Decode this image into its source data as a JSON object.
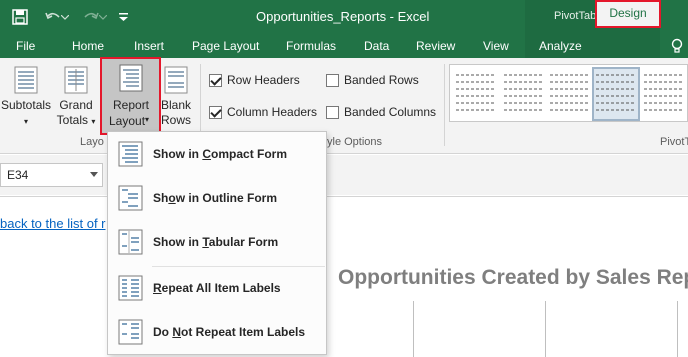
{
  "titlebar": {
    "document_title": "Opportunities_Reports - Excel",
    "context_tab_group": "PivotTable Tools",
    "save_icon": "save-icon",
    "undo_icon": "undo-icon",
    "redo_icon": "redo-icon",
    "customize_icon": "customize-qat-icon"
  },
  "tabs": {
    "file": "File",
    "home": "Home",
    "insert": "Insert",
    "page_layout": "Page Layout",
    "formulas": "Formulas",
    "data": "Data",
    "review": "Review",
    "view": "View",
    "analyze": "Analyze",
    "design": "Design"
  },
  "ribbon": {
    "subtotals_line1": "Subtotals",
    "grand_totals_line1": "Grand",
    "grand_totals_line2": "Totals",
    "report_layout_line1": "Report",
    "report_layout_line2": "Layout",
    "blank_rows_line1": "Blank",
    "blank_rows_line2": "Rows",
    "layout_group_label": "Layo",
    "style_options_group_label": "yle Options",
    "styles_group_label": "PivotT",
    "options": [
      {
        "label": "Row Headers",
        "checked": true
      },
      {
        "label": "Banded Rows",
        "checked": false
      },
      {
        "label": "Column Headers",
        "checked": true
      },
      {
        "label": "Banded Columns",
        "checked": false
      }
    ]
  },
  "formula_bar": {
    "name_box": "E34"
  },
  "sheet": {
    "link_text": "back to the list of r",
    "report_title": "Opportunities Created by Sales Rep"
  },
  "report_layout_menu": {
    "items": [
      {
        "pre": "Show in ",
        "key": "C",
        "post": "ompact Form"
      },
      {
        "pre": "Sh",
        "key": "o",
        "post": "w in Outline Form"
      },
      {
        "pre": "Show in ",
        "key": "T",
        "post": "abular Form"
      },
      {
        "pre": "",
        "key": "R",
        "post": "epeat All Item Labels"
      },
      {
        "pre": "Do ",
        "key": "N",
        "post": "ot Repeat Item Labels"
      }
    ]
  },
  "colors": {
    "excel_green": "#217346",
    "highlight_red": "#e4172b",
    "link_blue": "#0563c1"
  }
}
